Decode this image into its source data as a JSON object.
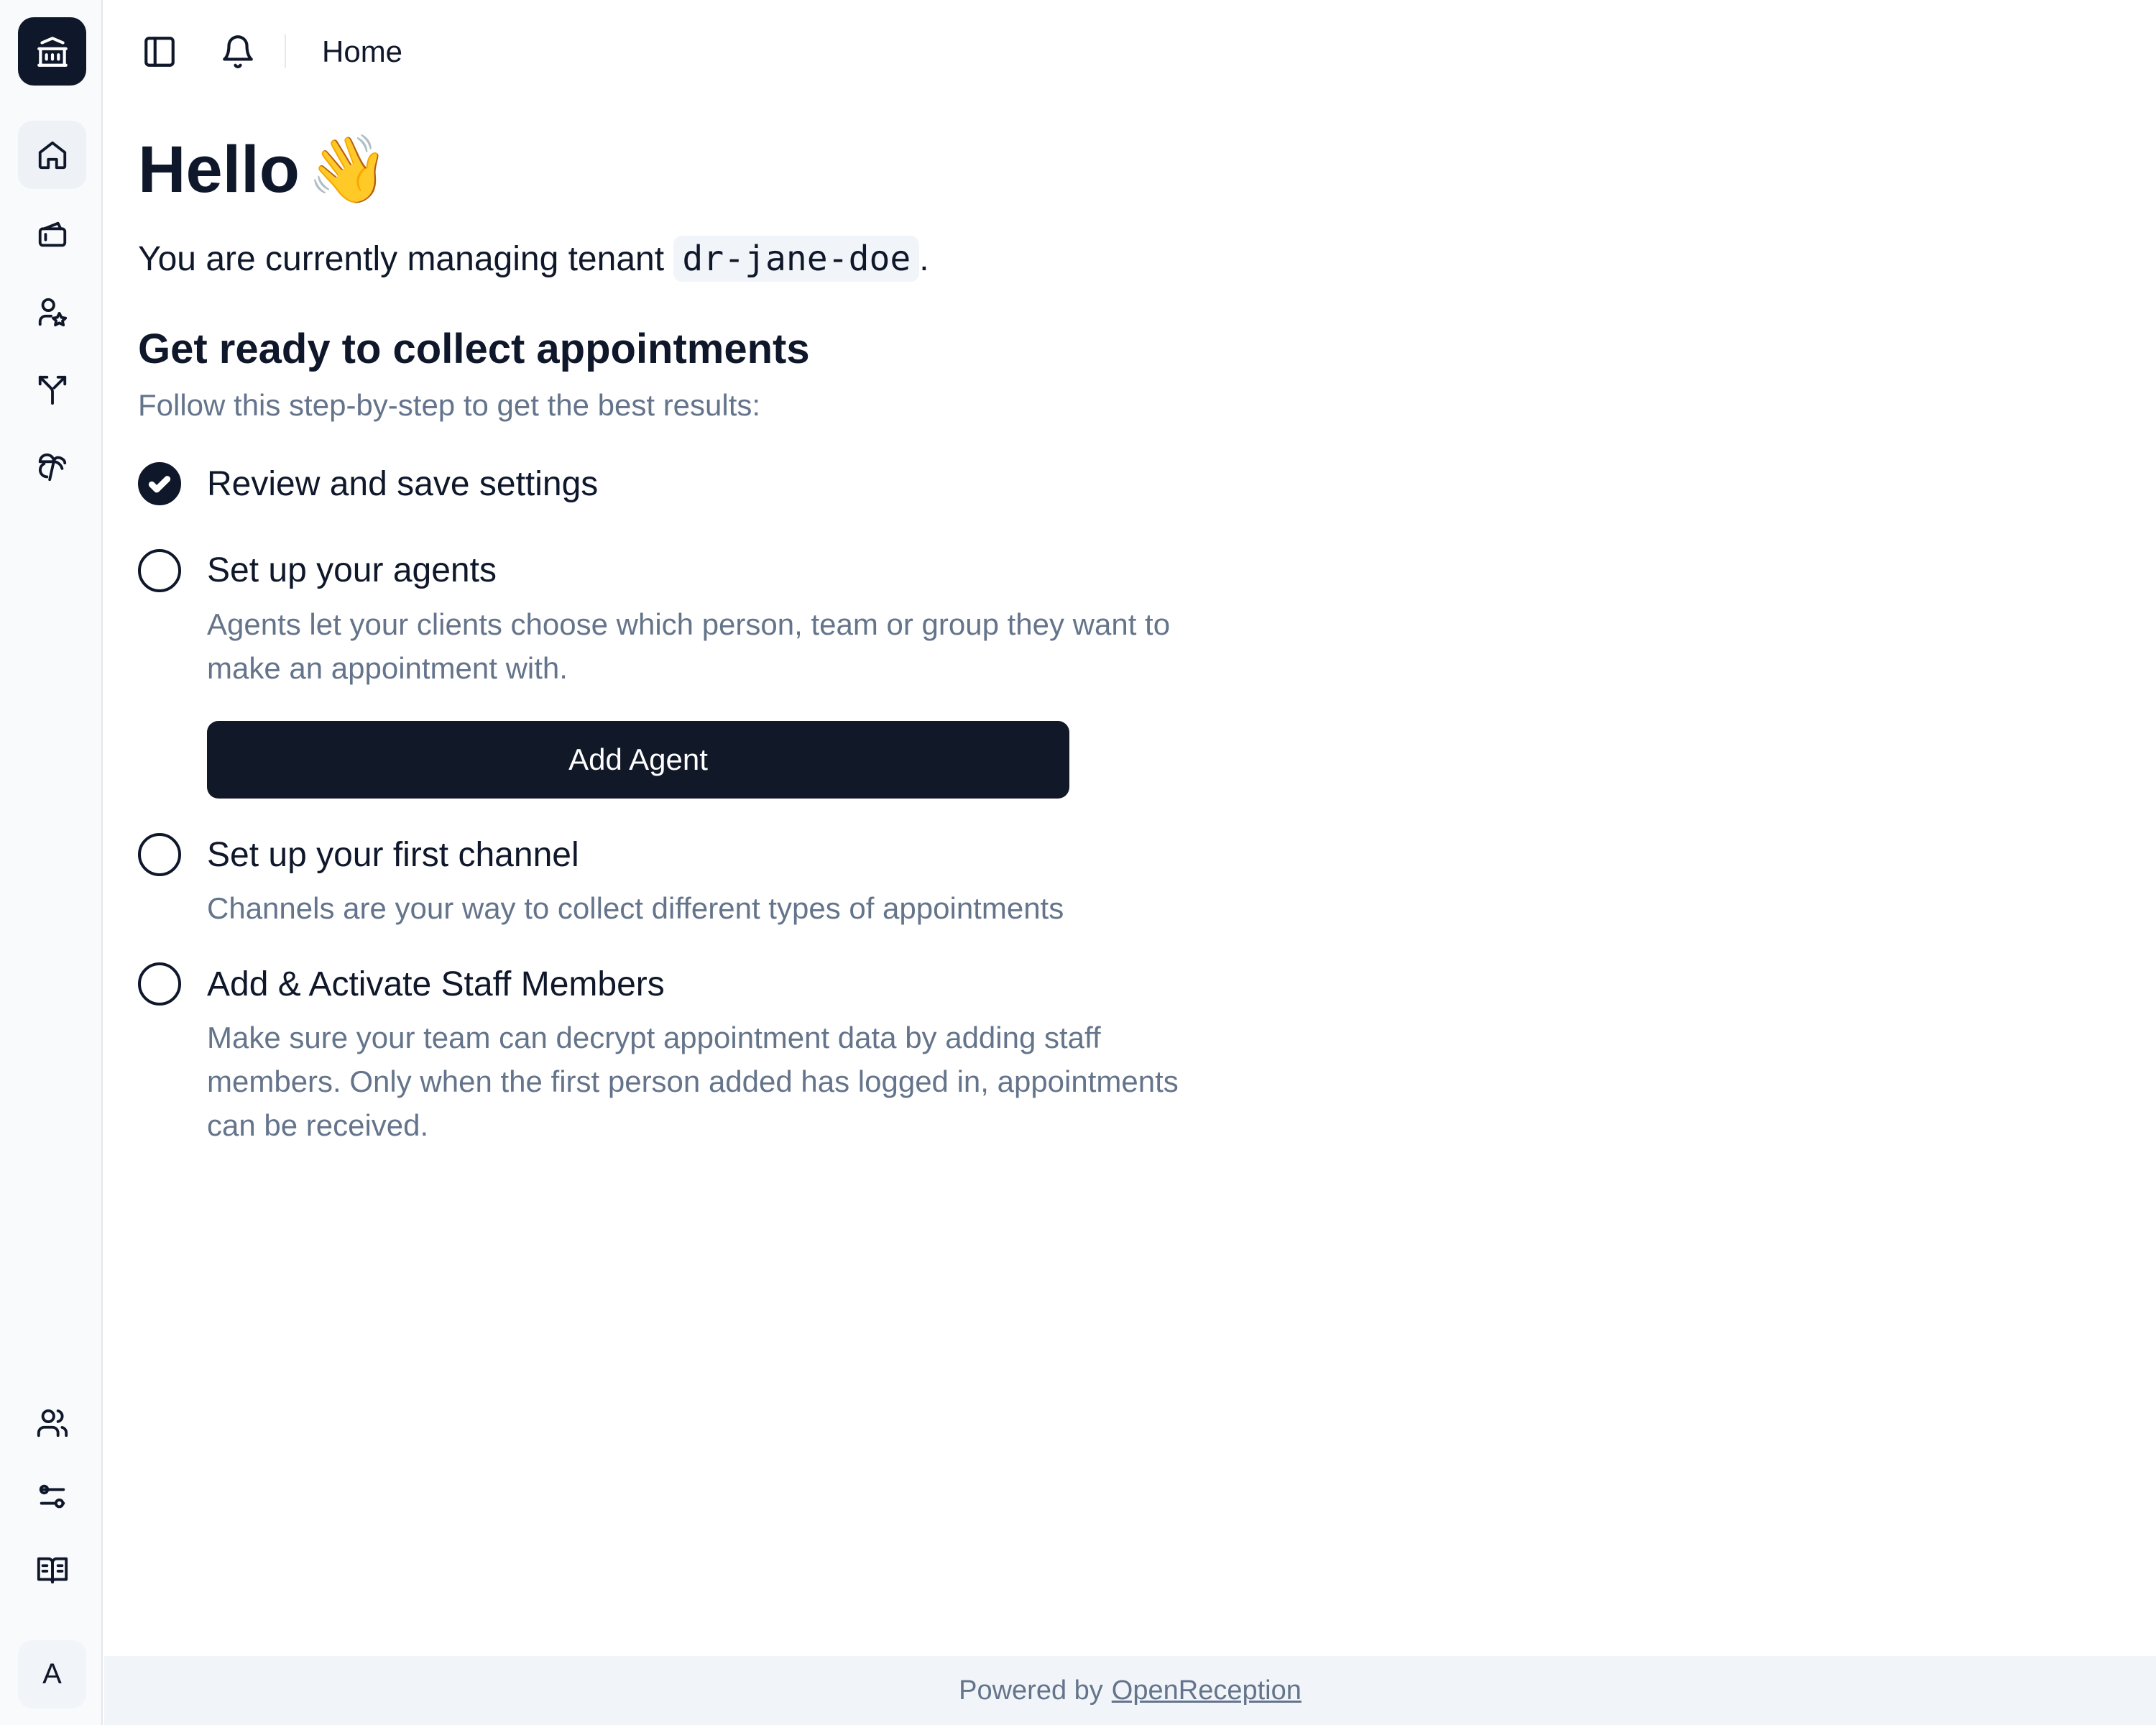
{
  "sidebar": {
    "logo_icon": "bank-icon",
    "top_items": [
      {
        "icon": "home-icon",
        "active": true
      },
      {
        "icon": "ticket-icon"
      },
      {
        "icon": "user-star-icon"
      },
      {
        "icon": "split-icon"
      },
      {
        "icon": "palm-tree-icon"
      }
    ],
    "bottom_items": [
      {
        "icon": "users-icon"
      },
      {
        "icon": "sliders-icon"
      },
      {
        "icon": "book-open-icon"
      }
    ],
    "avatar_initial": "A"
  },
  "topbar": {
    "title": "Home",
    "icons": [
      "sidebar-toggle-icon",
      "bell-icon"
    ]
  },
  "main": {
    "greeting": "Hello",
    "greeting_emoji": "👋",
    "tenant_prefix": "You are currently managing tenant",
    "tenant_name": "dr-jane-doe",
    "tenant_suffix": ".",
    "section_title": "Get ready to collect appointments",
    "section_subtitle": "Follow this step-by-step to get the best results:",
    "steps": [
      {
        "title": "Review and save settings",
        "done": true
      },
      {
        "title": "Set up your agents",
        "done": false,
        "description": "Agents let your clients choose which person, team or group they want to make an appointment with.",
        "button": "Add Agent"
      },
      {
        "title": "Set up your first channel",
        "done": false,
        "description": "Channels are your way to collect different types of appointments"
      },
      {
        "title": "Add & Activate Staff Members",
        "done": false,
        "description": "Make sure your team can decrypt appointment data by adding staff members. Only when the first person added has logged in, appointments can be received."
      }
    ]
  },
  "footer": {
    "prefix": "Powered by",
    "link": "OpenReception"
  },
  "colors": {
    "primary": "#0f172a",
    "muted_text": "#64748b",
    "sidebar_bg": "#f8fafc",
    "footer_bg": "#f1f5f9"
  }
}
